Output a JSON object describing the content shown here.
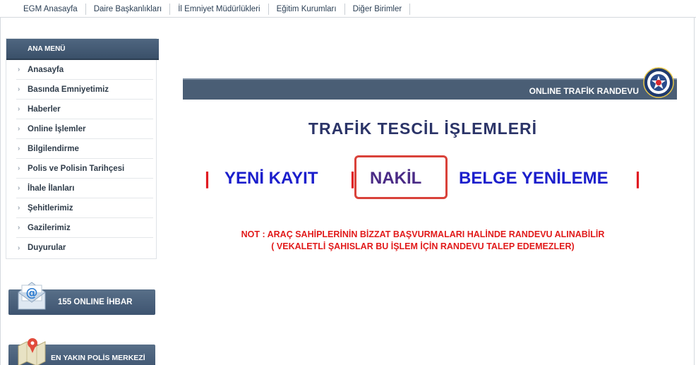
{
  "topnav": [
    "EGM Anasayfa",
    "Daire Başkanlıkları",
    "İl Emniyet Müdürlükleri",
    "Eğitim Kurumları",
    "Diğer Birimler"
  ],
  "sidebar": {
    "title": "ANA MENÜ",
    "items": [
      "Anasayfa",
      "Basında Emniyetimiz",
      "Haberler",
      "Online İşlemler",
      "Bilgilendirme",
      "Polis ve Polisin Tarihçesi",
      "İhale İlanları",
      "Şehitlerimiz",
      "Gazilerimiz",
      "Duyurular"
    ],
    "banner1": "155 ONLINE İHBAR",
    "banner2": "EN YAKIN POLİS MERKEZİ"
  },
  "main": {
    "bar_title": "ONLINE TRAFİK RANDEVU",
    "page_title": "TRAFİK TESCİL İŞLEMLERİ",
    "separator": "|",
    "options": [
      "YENİ KAYIT",
      "NAKİL",
      "BELGE YENİLEME"
    ],
    "selected_option": "NAKİL",
    "note_line1": "NOT : ARAÇ SAHİPLERİNİN BİZZAT BAŞVURMALARI HALİNDE RANDEVU ALINABİLİR",
    "note_line2": "( VEKALETLİ ŞAHISLAR BU İŞLEM İÇİN RANDEVU TALEP EDEMEZLER)"
  },
  "colors": {
    "header_bar": "#4a5e75",
    "title_text": "#2b3468",
    "link_blue": "#1c1fcc",
    "separator_red": "#e01b22",
    "note_red": "#e11a1a",
    "highlight": "#d9423a"
  },
  "icons": [
    "mail-icon",
    "map-icon",
    "police-emblem-icon",
    "chevron-right-icon"
  ]
}
